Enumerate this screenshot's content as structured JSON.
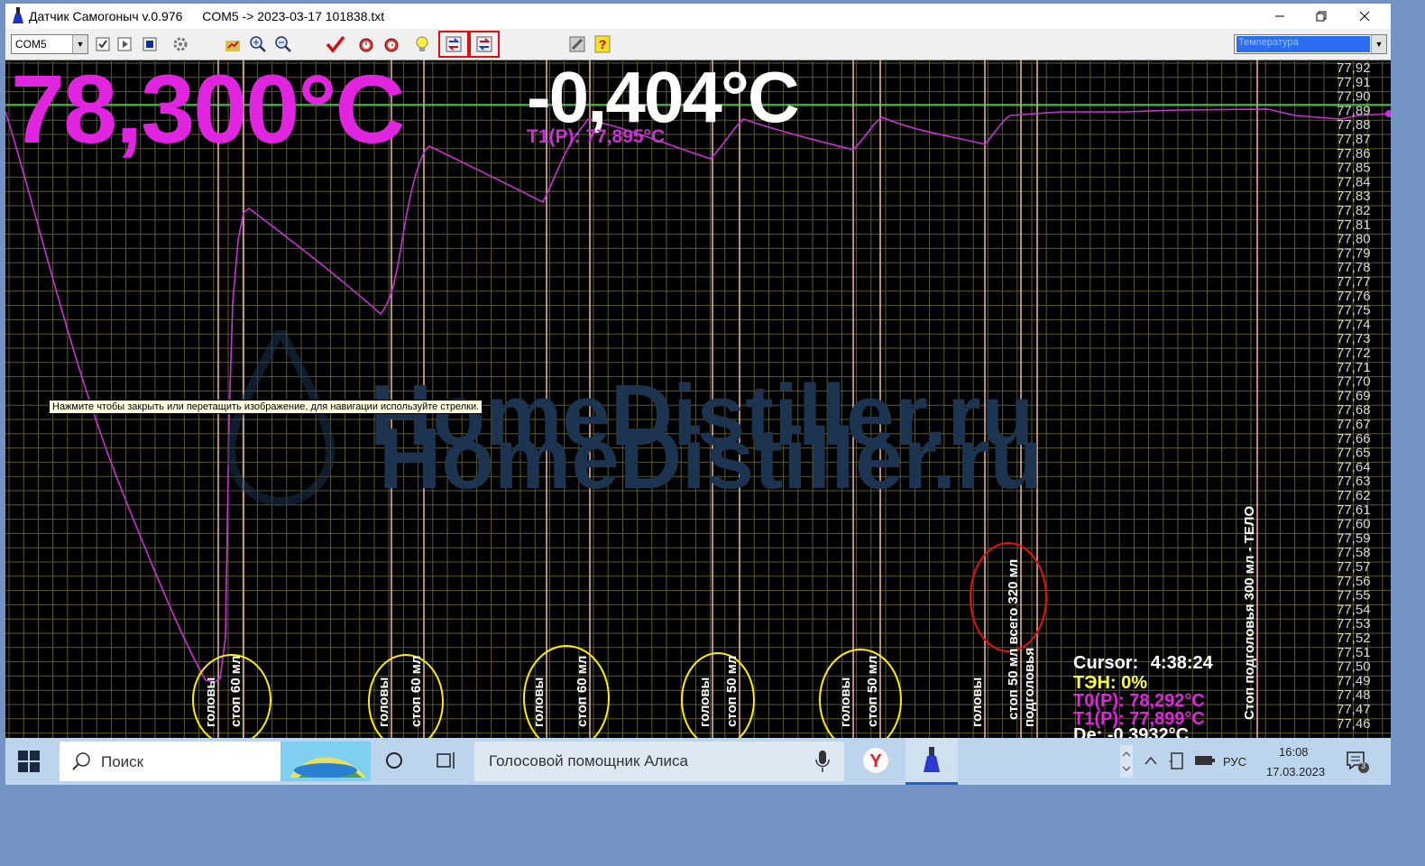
{
  "window": {
    "title": "Датчик Самогоныч v.0.976",
    "file": "COM5 -> 2023-03-17 101838.txt"
  },
  "toolbar": {
    "port_value": "COM5",
    "sensor_select_value": "Температура"
  },
  "display": {
    "main_temp": "78,300°C",
    "delta_temp": "-0,404°C",
    "t1_label": "T1(P): 77,895°C"
  },
  "cursor_info": {
    "cursor_label": "Cursor:",
    "cursor_time": "4:38:24",
    "heater": "ТЭН: 0%",
    "t0": "T0(P): 78,292°C",
    "t1": "T1(P): 77,899°C",
    "de": "De: -0,3932°C"
  },
  "tooltip": "Нажмите чтобы закрыть или перетащить изображение, для навигации используйте стрелки.",
  "watermark": "HomeDistiller.ru",
  "markers": [
    {
      "text": "головы"
    },
    {
      "text": "стоп 60 мл"
    },
    {
      "text": "головы"
    },
    {
      "text": "стоп 60 мл"
    },
    {
      "text": "головы"
    },
    {
      "text": "стоп 60 мл"
    },
    {
      "text": "головы"
    },
    {
      "text": "стоп 50 мл"
    },
    {
      "text": "головы"
    },
    {
      "text": "стоп 50 мл"
    },
    {
      "text": "головы"
    },
    {
      "text": "стоп 50 мл всего 320 мл"
    },
    {
      "text": "подголовья"
    },
    {
      "text": "Стоп подголовья 300 мл - ТЕЛО"
    }
  ],
  "y_axis_labels": [
    "77,92",
    "77,91",
    "77,90",
    "77,89",
    "77,88",
    "77,87",
    "77,86",
    "77,85",
    "77,84",
    "77,83",
    "77,82",
    "77,81",
    "77,80",
    "77,79",
    "77,78",
    "77,77",
    "77,76",
    "77,75",
    "77,74",
    "77,73",
    "77,72",
    "77,71",
    "77,70",
    "77,69",
    "77,68",
    "77,67",
    "77,66",
    "77,65",
    "77,64",
    "77,63",
    "77,62",
    "77,61",
    "77,60",
    "77,59",
    "77,58",
    "77,57",
    "77,56",
    "77,55",
    "77,54",
    "77,53",
    "77,52",
    "77,51",
    "77,50",
    "77,49",
    "77,48",
    "77,47",
    "77,46"
  ],
  "taskbar": {
    "search_placeholder": "Поиск",
    "assistant": "Голосовой помощник Алиса",
    "lang": "РУС",
    "time": "16:08",
    "date": "17.03.2023",
    "notifications": "3"
  },
  "colors": {
    "graph_line": "#c832d8",
    "grid": "#5b5b2e",
    "marker_line": "#f0b8a8",
    "main_temp": "#e024e0",
    "delta_temp": "#ffffff",
    "heater": "#ffff40",
    "highlight_yellow": "#ffee00",
    "highlight_red": "#e81010",
    "level_line": "#40e040"
  }
}
